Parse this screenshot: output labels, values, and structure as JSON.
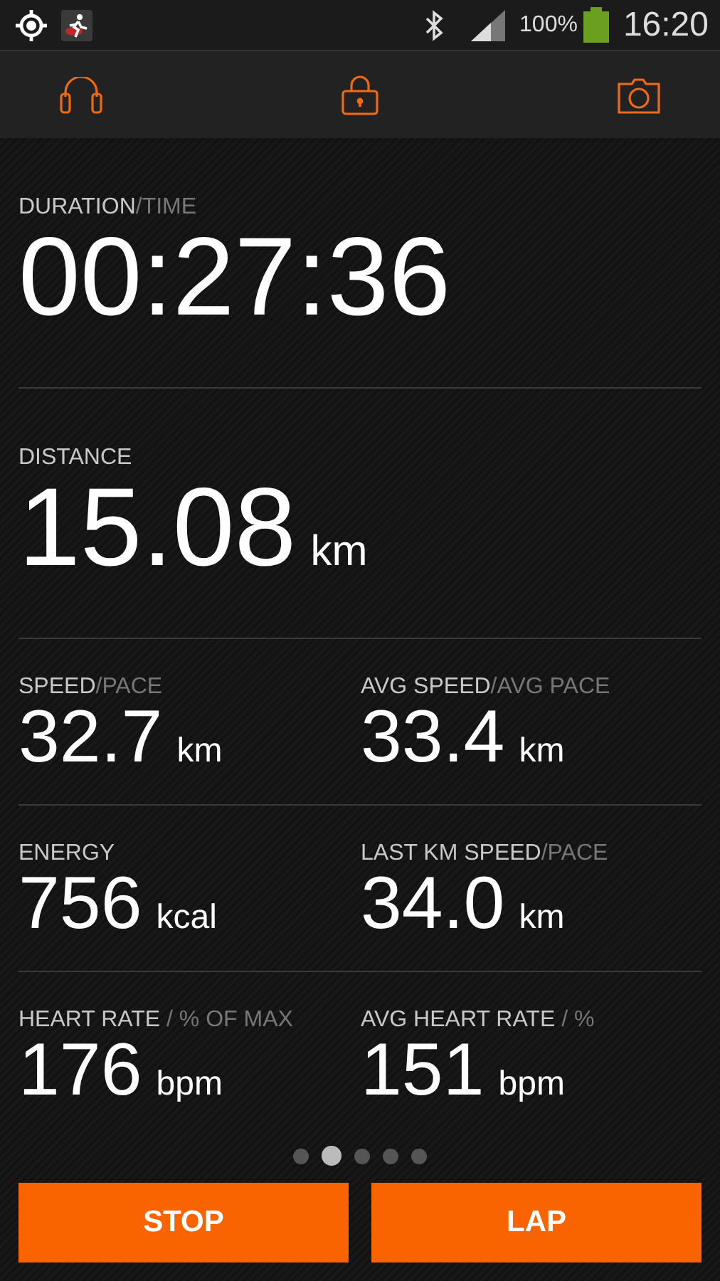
{
  "status_bar": {
    "battery_percent": "100%",
    "time": "16:20"
  },
  "sections": [
    {
      "kind": "hero",
      "cells": [
        {
          "label": "DURATION",
          "label_secondary": "/TIME",
          "value": "00:27:36"
        }
      ]
    },
    {
      "kind": "hero",
      "cells": [
        {
          "label": "DISTANCE",
          "value": "15.08",
          "unit": "km"
        }
      ]
    },
    {
      "kind": "pair",
      "cells": [
        {
          "label": "SPEED",
          "label_secondary": "/PACE",
          "value": "32.7",
          "unit": "km"
        },
        {
          "label": "AVG SPEED",
          "label_secondary": "/AVG PACE",
          "value": "33.4",
          "unit": "km"
        }
      ]
    },
    {
      "kind": "pair",
      "cells": [
        {
          "label": "ENERGY",
          "value": "756",
          "unit": "kcal"
        },
        {
          "label": "LAST KM SPEED",
          "label_secondary": "/PACE",
          "value": "34.0",
          "unit": "km"
        }
      ]
    },
    {
      "kind": "pair",
      "cells": [
        {
          "label": "HEART RATE",
          "label_secondary": " / % OF MAX",
          "value": "176",
          "unit": "bpm"
        },
        {
          "label": "AVG HEART RATE",
          "label_secondary": " / %",
          "value": "151",
          "unit": "bpm"
        }
      ]
    }
  ],
  "pages": [
    {
      "selected": false
    },
    {
      "selected": true
    },
    {
      "selected": false
    },
    {
      "selected": false
    },
    {
      "selected": false
    }
  ],
  "buttons": [
    "STOP",
    "LAP"
  ]
}
